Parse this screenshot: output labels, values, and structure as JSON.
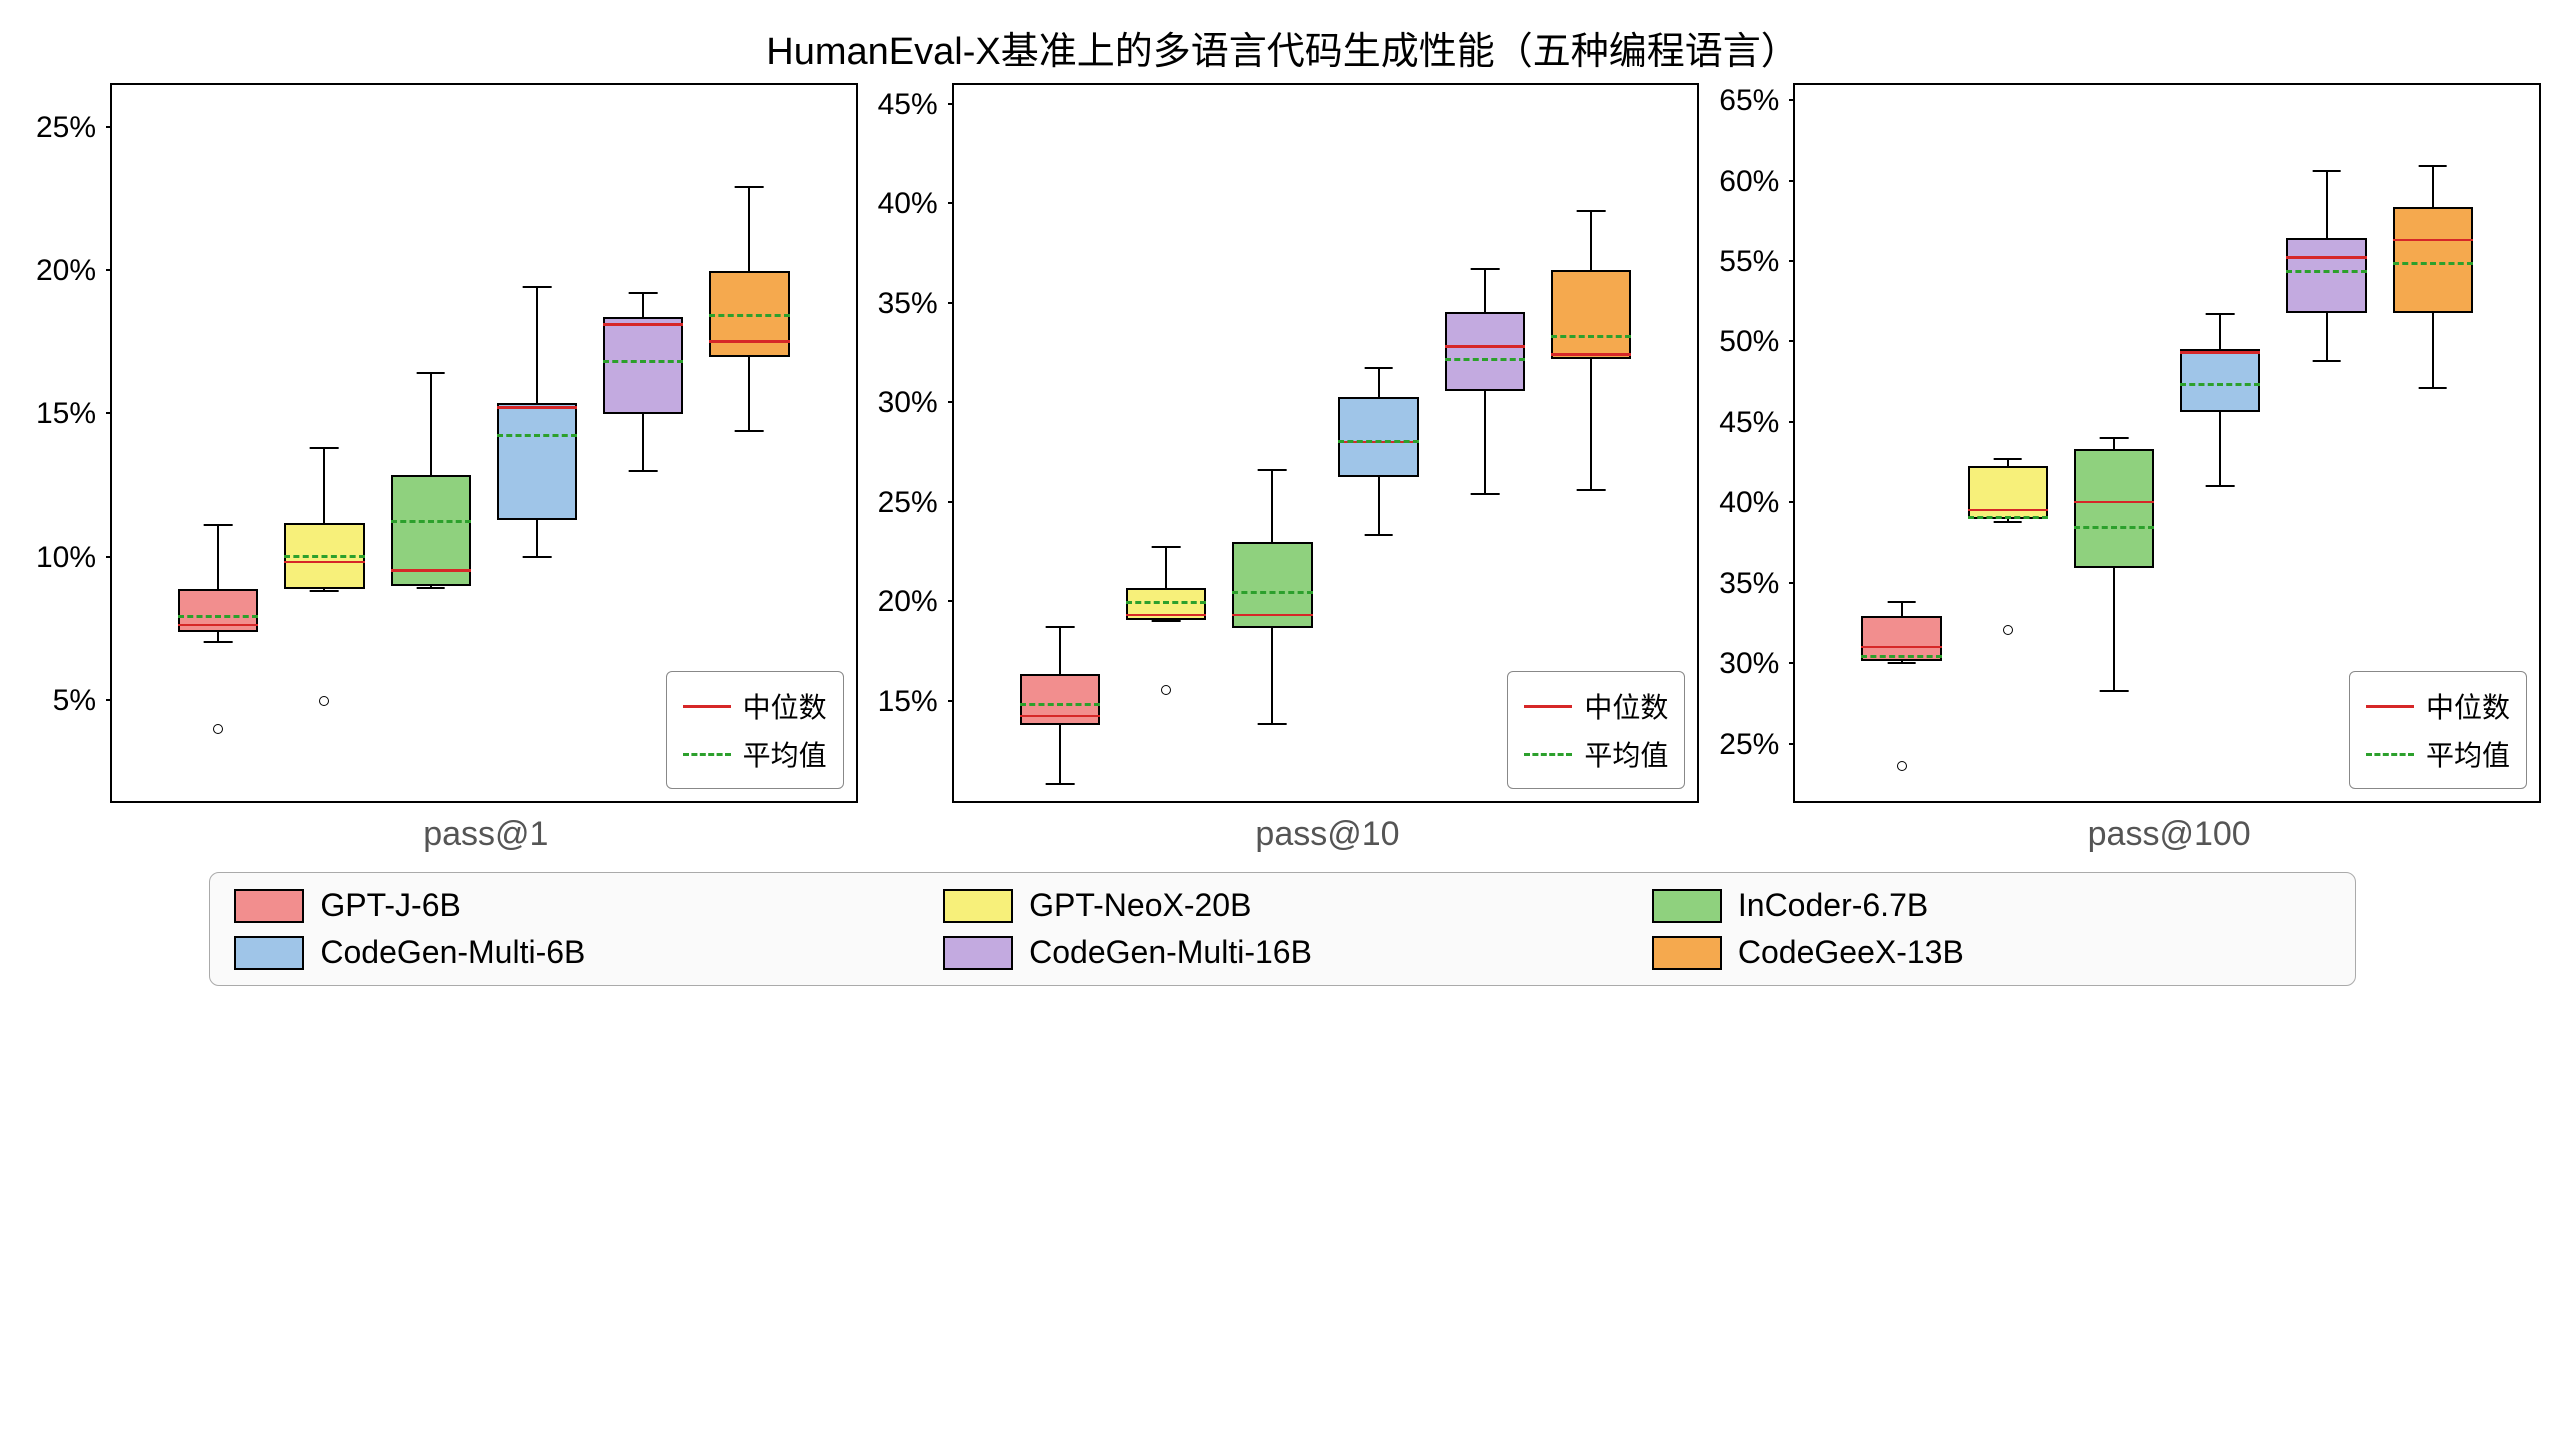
{
  "title": "HumanEval-X基准上的多语言代码生成性能（五种编程语言）",
  "models": [
    {
      "name": "GPT-J-6B",
      "color": "#f28e8e"
    },
    {
      "name": "GPT-NeoX-20B",
      "color": "#f7f07a"
    },
    {
      "name": "InCoder-6.7B",
      "color": "#8fd17e"
    },
    {
      "name": "CodeGen-Multi-6B",
      "color": "#9fc5e8"
    },
    {
      "name": "CodeGen-Multi-16B",
      "color": "#c3aae0"
    },
    {
      "name": "CodeGeeX-13B",
      "color": "#f5a94e"
    }
  ],
  "mini_legend": {
    "median": "中位数",
    "mean": "平均值"
  },
  "chart_data": [
    {
      "xlabel": "pass@1",
      "ylim": [
        1.5,
        26.5
      ],
      "yticks": [
        5,
        10,
        15,
        20,
        25
      ],
      "ytick_labels": [
        "5%",
        "10%",
        "15%",
        "20%",
        "25%"
      ],
      "series": [
        {
          "name": "GPT-J-6B",
          "low": 7.0,
          "q1": 7.4,
          "median": 7.6,
          "mean": 7.9,
          "q3": 8.9,
          "high": 11.1,
          "outliers": [
            4.0
          ]
        },
        {
          "name": "GPT-NeoX-20B",
          "low": 8.8,
          "q1": 8.9,
          "median": 9.8,
          "mean": 10.0,
          "q3": 11.2,
          "high": 13.8,
          "outliers": [
            5.0
          ]
        },
        {
          "name": "InCoder-6.7B",
          "low": 8.9,
          "q1": 9.0,
          "median": 9.5,
          "mean": 11.2,
          "q3": 12.9,
          "high": 16.4,
          "outliers": []
        },
        {
          "name": "CodeGen-Multi-6B",
          "low": 10.0,
          "q1": 11.3,
          "median": 15.2,
          "mean": 14.2,
          "q3": 15.4,
          "high": 19.4,
          "outliers": []
        },
        {
          "name": "CodeGen-Multi-16B",
          "low": 13.0,
          "q1": 15.0,
          "median": 18.1,
          "mean": 16.8,
          "q3": 18.4,
          "high": 19.2,
          "outliers": []
        },
        {
          "name": "CodeGeeX-13B",
          "low": 14.4,
          "q1": 17.0,
          "median": 17.5,
          "mean": 18.4,
          "q3": 20.0,
          "high": 22.9,
          "outliers": []
        }
      ]
    },
    {
      "xlabel": "pass@10",
      "ylim": [
        10,
        46
      ],
      "yticks": [
        15,
        20,
        25,
        30,
        35,
        40,
        45
      ],
      "ytick_labels": [
        "15%",
        "20%",
        "25%",
        "30%",
        "35%",
        "40%",
        "45%"
      ],
      "series": [
        {
          "name": "GPT-J-6B",
          "low": 10.8,
          "q1": 13.8,
          "median": 14.2,
          "mean": 14.8,
          "q3": 16.4,
          "high": 18.7,
          "outliers": []
        },
        {
          "name": "GPT-NeoX-20B",
          "low": 19.0,
          "q1": 19.1,
          "median": 19.3,
          "mean": 19.9,
          "q3": 20.7,
          "high": 22.7,
          "outliers": [
            15.6
          ]
        },
        {
          "name": "InCoder-6.7B",
          "low": 13.8,
          "q1": 18.7,
          "median": 19.3,
          "mean": 20.4,
          "q3": 23.0,
          "high": 26.6,
          "outliers": []
        },
        {
          "name": "CodeGen-Multi-6B",
          "low": 23.3,
          "q1": 26.3,
          "median": 28.0,
          "mean": 28.0,
          "q3": 30.3,
          "high": 31.7,
          "outliers": []
        },
        {
          "name": "CodeGen-Multi-16B",
          "low": 25.4,
          "q1": 30.6,
          "median": 32.8,
          "mean": 32.1,
          "q3": 34.6,
          "high": 36.7,
          "outliers": []
        },
        {
          "name": "CodeGeeX-13B",
          "low": 25.6,
          "q1": 32.2,
          "median": 32.4,
          "mean": 33.3,
          "q3": 36.7,
          "high": 39.6,
          "outliers": []
        }
      ]
    },
    {
      "xlabel": "pass@100",
      "ylim": [
        21.5,
        66
      ],
      "yticks": [
        25,
        30,
        35,
        40,
        45,
        50,
        55,
        60,
        65
      ],
      "ytick_labels": [
        "25%",
        "30%",
        "35%",
        "40%",
        "45%",
        "50%",
        "55%",
        "60%",
        "65%"
      ],
      "series": [
        {
          "name": "GPT-J-6B",
          "low": 30.0,
          "q1": 30.2,
          "median": 31.0,
          "mean": 30.4,
          "q3": 33.0,
          "high": 33.8,
          "outliers": [
            23.7
          ]
        },
        {
          "name": "GPT-NeoX-20B",
          "low": 38.8,
          "q1": 39.0,
          "median": 39.5,
          "mean": 39.0,
          "q3": 42.3,
          "high": 42.7,
          "outliers": [
            32.1
          ]
        },
        {
          "name": "InCoder-6.7B",
          "low": 28.3,
          "q1": 36.0,
          "median": 40.0,
          "mean": 38.4,
          "q3": 43.4,
          "high": 44.0,
          "outliers": []
        },
        {
          "name": "CodeGen-Multi-6B",
          "low": 41.0,
          "q1": 45.7,
          "median": 49.3,
          "mean": 47.3,
          "q3": 49.6,
          "high": 51.7,
          "outliers": []
        },
        {
          "name": "CodeGen-Multi-16B",
          "low": 48.8,
          "q1": 51.8,
          "median": 55.2,
          "mean": 54.3,
          "q3": 56.5,
          "high": 60.6,
          "outliers": []
        },
        {
          "name": "CodeGeeX-13B",
          "low": 47.1,
          "q1": 51.8,
          "median": 56.3,
          "mean": 54.8,
          "q3": 58.4,
          "high": 60.9,
          "outliers": []
        }
      ]
    }
  ]
}
